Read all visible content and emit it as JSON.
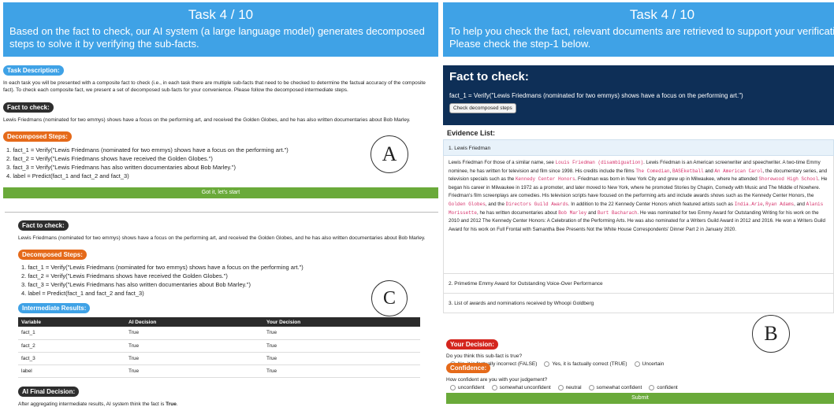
{
  "left": {
    "header": {
      "title": "Task 4 / 10",
      "subtitle": "Based on the fact to check, our AI system (a large language model) generates decomposed steps to solve it by verifying the sub-facts."
    },
    "task_description": {
      "label": "Task Description:",
      "text": "In each task you will be presented with a composite fact to check (i.e., in each task there are multiple sub-facts that need to be checked to determine the factual accuracy of the composite fact). To check each composite fact, we present a set of decomposed sub-facts for your convenience. Please follow the decomposed intermediate steps."
    },
    "fact_to_check": {
      "label": "Fact to check:",
      "text": "Lewis Friedmans (nominated for two emmys) shows have a focus on the performing art, and received the Golden Globes, and he has also written documentaries about Bob Marley."
    },
    "decomposed": {
      "label": "Decomposed Steps:",
      "steps": [
        "1. fact_1 = Verify(\"Lewis Friedmans (nominated for two emmys) shows have a focus on the performing art.\")",
        "2. fact_2 = Verify(\"Lewis Friedmans shows have received the Golden Globes.\")",
        "3. fact_3 = Verify(\"Lewis Friedmans has also written documentaries about Bob Marley.\")",
        "4. label = Predict(fact_1 and fact_2 and fact_3)"
      ]
    },
    "got_it_label": "Got it, let's start",
    "circle_a": "A",
    "panel_c": {
      "fact_label": "Fact to check:",
      "fact_text": "Lewis Friedmans (nominated for two emmys) shows have a focus on the performing art, and received the Golden Globes, and he has also written documentaries about Bob Marley.",
      "decomposed_label": "Decomposed Steps:",
      "steps": [
        "1. fact_1 = Verify(\"Lewis Friedmans (nominated for two emmys) shows have a focus on the performing art.\")",
        "2. fact_2 = Verify(\"Lewis Friedmans shows have received the Golden Globes.\")",
        "3. fact_3 = Verify(\"Lewis Friedmans has also written documentaries about Bob Marley.\")",
        "4. label = Predict(fact_1 and fact_2 and fact_3)"
      ],
      "intermediate_label": "Intermediate Results:",
      "table": {
        "headers": [
          "Variable",
          "AI Decision",
          "Your Decision"
        ],
        "rows": [
          [
            "fact_1",
            "True",
            "True"
          ],
          [
            "fact_2",
            "True",
            "True"
          ],
          [
            "fact_3",
            "True",
            "True"
          ],
          [
            "label",
            "True",
            "True"
          ]
        ]
      },
      "final_label": "AI Final Decision:",
      "final_text_prefix": "After aggregating intermediate results, AI system think the fact is ",
      "final_value": "True",
      "final_text_suffix": "."
    },
    "circle_c": "C"
  },
  "right": {
    "header": {
      "title": "Task 4 / 10",
      "line1": "To help you check the fact, relevant documents are retrieved to support your verification.",
      "line2": "Please check the step-1 below."
    },
    "fact_box": {
      "title": "Fact to check:",
      "text": "fact_1 = Verify(\"Lewis Friedmans (nominated for two emmys) shows have a focus on the performing art.\")",
      "button": "Check decomposed steps"
    },
    "evidence": {
      "title": "Evidence List:",
      "doc1_title": "1. Lewis Friedman",
      "doc1_body": [
        {
          "t": "Lewis Friedman For those of a similar name, see "
        },
        {
          "t": "Louis Friedman (disambiguation)",
          "hl": true
        },
        {
          "t": ". Lewis Friedman is an American screenwriter and speechwriter. A two-time Emmy nominee, he has written for television and film since 1998. His credits include the films "
        },
        {
          "t": "The Comedian",
          "hl": true
        },
        {
          "t": ", "
        },
        {
          "t": "BASEketball",
          "hl": true
        },
        {
          "t": " and "
        },
        {
          "t": "An American Carol",
          "hl": true
        },
        {
          "t": ", the documentary series, and television specials such as the "
        },
        {
          "t": "Kennedy Center Honors",
          "hl": true
        },
        {
          "t": ". Friedman was born in New York City and grew up in Milwaukee, where he attended "
        },
        {
          "t": "Shorewood High School",
          "hl": true
        },
        {
          "t": ". He began his career in Milwaukee in 1972 as a promoter, and later moved to New York, where he promoted Stories by Chapin, Comedy with Music and The Middle of Nowhere. Friedman's film screenplays are comedies. His television scripts have focused on the performing arts and include awards shows such as the Kennedy Center Honors, the "
        },
        {
          "t": "Golden Globes",
          "hl": true
        },
        {
          "t": ", and the "
        },
        {
          "t": "Directors Guild Awards",
          "hl": true
        },
        {
          "t": ". In addition to the 22 Kennedy Center Honors which featured artists such as "
        },
        {
          "t": "India.Arie",
          "hl": true
        },
        {
          "t": ", "
        },
        {
          "t": "Ryan Adams",
          "hl": true
        },
        {
          "t": ", and "
        },
        {
          "t": "Alanis Morissette",
          "hl": true
        },
        {
          "t": ", he has written documentaries about "
        },
        {
          "t": "Bob Marley",
          "hl": true
        },
        {
          "t": " and "
        },
        {
          "t": "Burt Bacharach",
          "hl": true
        },
        {
          "t": ". He was nominated for two Emmy Award for Outstanding Writing for his work on the 2010 and 2012 The Kennedy Center Honors: A Celebration of the Performing Arts. He was also nominated for a Writers Guild Award in 2012 and 2016. He won a Writers Guild Award for his work on Full Frontal with Samantha Bee Presents Not the White House Correspondents' Dinner Part 2 in January 2020."
        }
      ],
      "doc2_title": "2. Primetime Emmy Award for Outstanding Voice-Over Performance",
      "doc3_title": "3. List of awards and nominations received by Whoopi Goldberg"
    },
    "decision": {
      "label": "Your Decision:",
      "question": "Do you think this sub-fact is true?",
      "options": [
        "No, it is factually incorrect (FALSE)",
        "Yes, it is factually correct (TRUE)",
        "Uncertain"
      ]
    },
    "confidence": {
      "label": "Confidence:",
      "question": "How confident are you with your judgement?",
      "options": [
        "unconfident",
        "somewhat unconfident",
        "neutral",
        "somewhat confident",
        "confident"
      ]
    },
    "submit_label": "Submit",
    "circle_b": "B"
  }
}
